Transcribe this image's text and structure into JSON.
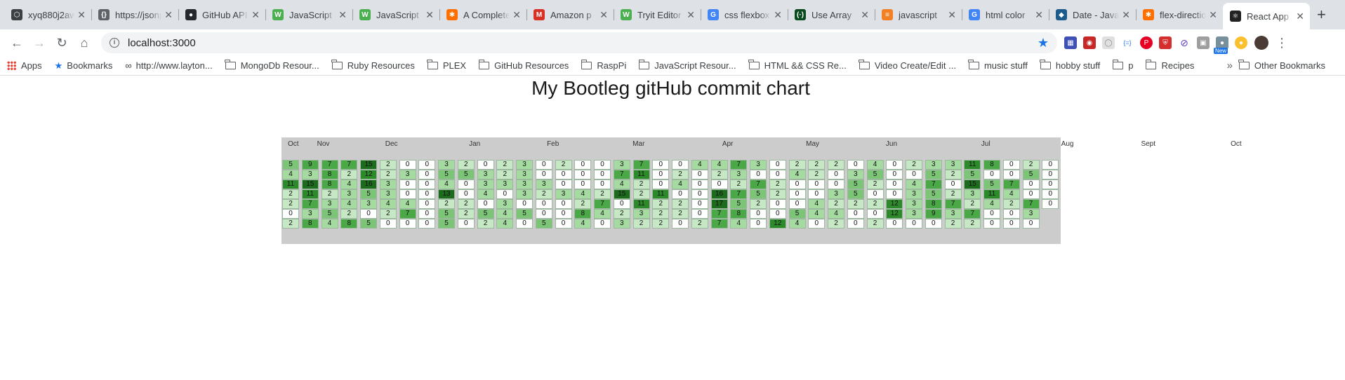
{
  "browser": {
    "tabs": [
      {
        "title": "xyq880j2aw",
        "icon": "cube-icon",
        "color": "#3c4043",
        "glyph": "⬡"
      },
      {
        "title": "https://jsonplaceholder",
        "icon": "json-icon",
        "color": "#5f6368",
        "glyph": "{}"
      },
      {
        "title": "GitHub API",
        "icon": "github-icon",
        "color": "#24292e",
        "glyph": "●"
      },
      {
        "title": "JavaScript",
        "icon": "w3schools-icon",
        "color": "#4caf50",
        "glyph": "W"
      },
      {
        "title": "JavaScript",
        "icon": "w3schools-icon",
        "color": "#4caf50",
        "glyph": "W"
      },
      {
        "title": "A Complete",
        "icon": "medium-icon",
        "color": "#ff6f00",
        "glyph": "✱"
      },
      {
        "title": "Amazon p",
        "icon": "gmail-icon",
        "color": "#d93025",
        "glyph": "M"
      },
      {
        "title": "Tryit Editor",
        "icon": "w3schools-icon",
        "color": "#4caf50",
        "glyph": "W"
      },
      {
        "title": "css flexbox",
        "icon": "google-icon",
        "color": "#4285f4",
        "glyph": "G"
      },
      {
        "title": "Use Array",
        "icon": "freecodecamp-icon",
        "color": "#0a4a1e",
        "glyph": "(·)"
      },
      {
        "title": "javascript",
        "icon": "stackoverflow-icon",
        "color": "#f48024",
        "glyph": "≡"
      },
      {
        "title": "html color",
        "icon": "google-icon",
        "color": "#4285f4",
        "glyph": "G"
      },
      {
        "title": "Date - JavaScript",
        "icon": "mdn-icon",
        "color": "#1d5c8a",
        "glyph": "◆"
      },
      {
        "title": "flex-direction",
        "icon": "medium-icon",
        "color": "#ff6f00",
        "glyph": "✱"
      },
      {
        "title": "React App",
        "icon": "react-icon",
        "color": "#222222",
        "glyph": "⚛",
        "active": true
      }
    ],
    "new_tab": "+",
    "url": "localhost:3000",
    "bookmarks": [
      {
        "label": "Apps",
        "type": "apps"
      },
      {
        "label": "Bookmarks",
        "type": "star"
      },
      {
        "label": "http://www.layton...",
        "type": "link"
      },
      {
        "label": "MongoDb Resour...",
        "type": "folder"
      },
      {
        "label": "Ruby Resources",
        "type": "folder"
      },
      {
        "label": "PLEX",
        "type": "folder"
      },
      {
        "label": "GitHub Resources",
        "type": "folder"
      },
      {
        "label": "RaspPi",
        "type": "folder"
      },
      {
        "label": "JavaScript Resour...",
        "type": "folder"
      },
      {
        "label": "HTML && CSS Re...",
        "type": "folder"
      },
      {
        "label": "Video Create/Edit ...",
        "type": "folder"
      },
      {
        "label": "music stuff",
        "type": "folder"
      },
      {
        "label": "hobby stuff",
        "type": "folder"
      },
      {
        "label": "p",
        "type": "folder"
      },
      {
        "label": "Recipes",
        "type": "folder"
      }
    ],
    "bookmarks_overflow": "»",
    "other_bookmarks": "Other Bookmarks",
    "new_badge": "New"
  },
  "page": {
    "title": "My Bootleg gitHub commit chart"
  },
  "chart": {
    "months": [
      {
        "label": "Oct",
        "week": 0
      },
      {
        "label": "Nov",
        "week": 1.5
      },
      {
        "label": "Dec",
        "week": 5
      },
      {
        "label": "Jan",
        "week": 9.3
      },
      {
        "label": "Feb",
        "week": 13.3
      },
      {
        "label": "Mar",
        "week": 17.7
      },
      {
        "label": "Apr",
        "week": 22.3
      },
      {
        "label": "May",
        "week": 26.6
      },
      {
        "label": "Jun",
        "week": 30.7
      },
      {
        "label": "Jul",
        "week": 35.6
      },
      {
        "label": "Aug",
        "week": 39.7
      },
      {
        "label": "Sept",
        "week": 43.8
      },
      {
        "label": "Oct",
        "week": 48.4
      }
    ],
    "rows": [
      [
        5,
        9,
        7,
        7,
        15,
        2,
        0,
        0,
        3,
        2,
        0,
        2,
        3,
        0,
        2,
        0,
        0,
        3,
        7,
        0,
        0,
        4,
        4,
        7,
        3,
        0,
        2,
        2,
        2,
        0,
        4,
        0,
        2,
        3,
        3,
        11,
        8,
        0,
        2,
        0
      ],
      [
        4,
        3,
        8,
        2,
        12,
        2,
        3,
        0,
        5,
        5,
        3,
        2,
        3,
        0,
        0,
        0,
        0,
        7,
        11,
        0,
        2,
        0,
        2,
        3,
        0,
        0,
        4,
        2,
        0,
        3,
        5,
        0,
        0,
        5,
        2,
        5,
        0,
        0,
        5,
        0
      ],
      [
        11,
        15,
        8,
        4,
        16,
        3,
        0,
        0,
        4,
        0,
        3,
        3,
        3,
        3,
        0,
        0,
        0,
        4,
        2,
        0,
        4,
        0,
        0,
        2,
        7,
        2,
        0,
        0,
        0,
        5,
        2,
        0,
        4,
        7,
        0,
        15,
        5,
        7,
        0,
        0
      ],
      [
        2,
        11,
        2,
        3,
        5,
        3,
        0,
        0,
        13,
        0,
        4,
        0,
        3,
        2,
        3,
        4,
        2,
        15,
        2,
        11,
        0,
        0,
        16,
        7,
        5,
        2,
        0,
        0,
        3,
        5,
        0,
        0,
        3,
        5,
        2,
        3,
        11,
        4,
        0,
        0
      ],
      [
        2,
        7,
        3,
        4,
        3,
        4,
        4,
        0,
        2,
        2,
        0,
        3,
        0,
        0,
        0,
        2,
        7,
        0,
        11,
        2,
        2,
        0,
        17,
        5,
        2,
        0,
        0,
        4,
        2,
        2,
        2,
        12,
        3,
        8,
        7,
        2,
        4,
        2,
        7,
        0
      ],
      [
        0,
        3,
        5,
        2,
        0,
        2,
        7,
        0,
        5,
        2,
        5,
        4,
        5,
        0,
        0,
        8,
        4,
        2,
        3,
        2,
        2,
        0,
        7,
        8,
        0,
        0,
        5,
        4,
        4,
        0,
        0,
        12,
        3,
        9,
        3,
        7,
        0,
        0,
        3,
        null
      ],
      [
        2,
        8,
        4,
        8,
        5,
        0,
        0,
        0,
        5,
        0,
        2,
        4,
        0,
        5,
        0,
        4,
        0,
        3,
        2,
        2,
        0,
        2,
        7,
        4,
        0,
        12,
        4,
        0,
        2,
        0,
        2,
        0,
        0,
        0,
        2,
        2,
        0,
        0,
        0,
        null
      ]
    ],
    "colors": {
      "level0": "#ffffff",
      "level1": "#c6e8c4",
      "level2": "#a5dba1",
      "level3": "#7cc577",
      "level4": "#4aa846",
      "level5": "#2d8a2a",
      "level6": "#1d6b1c",
      "background": "#cccccc"
    }
  }
}
